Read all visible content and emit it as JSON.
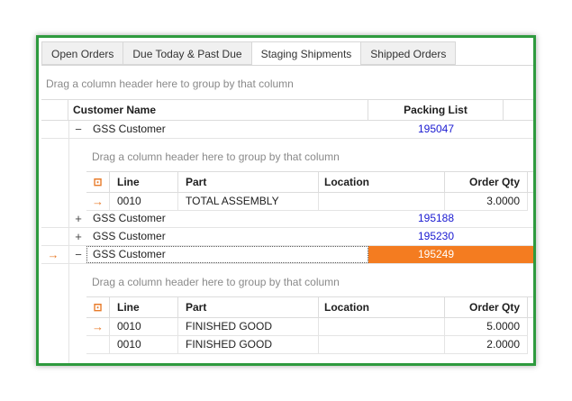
{
  "tabs": [
    {
      "label": "Open Orders"
    },
    {
      "label": "Due Today & Past Due"
    },
    {
      "label": "Staging Shipments"
    },
    {
      "label": "Shipped Orders"
    }
  ],
  "grid": {
    "group_panel": "Drag a column header here to group by that column",
    "columns": {
      "customer": "Customer Name",
      "packing": "Packing List"
    },
    "rows": [
      {
        "expander": "−",
        "customer": "GSS Customer",
        "packing": "195047"
      },
      {
        "expander": "+",
        "customer": "GSS Customer",
        "packing": "195188"
      },
      {
        "expander": "+",
        "customer": "GSS Customer",
        "packing": "195230"
      },
      {
        "expander": "−",
        "customer": "GSS Customer",
        "packing": "195249"
      }
    ],
    "row_indicator_icon": "arrow-right-icon"
  },
  "detail": {
    "group_panel": "Drag a column header here to group by that column",
    "columns": {
      "line": "Line",
      "part": "Part",
      "location": "Location",
      "order_qty": "Order Qty"
    },
    "header_icon": "column-chooser-icon",
    "sets": [
      {
        "rows": [
          {
            "line": "0010",
            "part": "TOTAL ASSEMBLY",
            "location": "",
            "order_qty": "3.0000"
          }
        ]
      },
      {
        "rows": [
          {
            "line": "0010",
            "part": "FINISHED GOOD",
            "location": "",
            "order_qty": "5.0000"
          },
          {
            "line": "0010",
            "part": "FINISHED GOOD",
            "location": "",
            "order_qty": "2.0000"
          }
        ]
      }
    ]
  },
  "colors": {
    "frame": "#2e9a3e",
    "selected": "#f47c20",
    "link": "#1a1ad1",
    "arrow": "#e87b2a"
  }
}
